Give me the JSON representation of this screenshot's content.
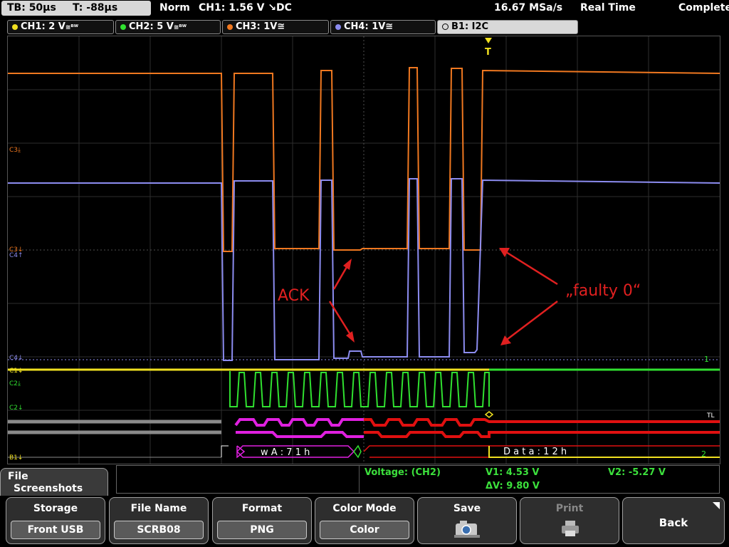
{
  "status_bar": {
    "timebase": "TB: 50µs",
    "trigger_time": "T: -88µs",
    "trigger_mode": "Norm",
    "trigger_setting": "CH1: 1.56 V ↘DC",
    "sample_rate": "16.67 MSa/s",
    "acquisition_mode": "Real Time",
    "acquisition_state": "Complete"
  },
  "channels": [
    {
      "label": "CH1: 2 V",
      "coupling": "≅ᴮᵂ",
      "color": "#f0e020"
    },
    {
      "label": "CH2: 5 V",
      "coupling": "≅ᴮᵂ",
      "color": "#30e030"
    },
    {
      "label": "CH3: 1V",
      "coupling": "≅",
      "color": "#f07820"
    },
    {
      "label": "CH4: 1V",
      "coupling": "≅",
      "color": "#8c8cf0"
    }
  ],
  "bus": {
    "label": "B1:  I2C",
    "decode_address": "w A : 7 1 h",
    "decode_data": "D a t a : 1 2 h"
  },
  "trace_markers": {
    "c3_top": "C3⤓",
    "c3_mid": "C3↓",
    "c4_mid": "C4↑",
    "c4_bottom": "C4↓",
    "c1": "C1↓",
    "c2_top": "C2⤓",
    "c2_bottom": "C2↓",
    "b1": "B1↓",
    "trigger": "T",
    "tl": "TL",
    "right_1": "1",
    "right_2": "2"
  },
  "annotations": {
    "ack": "ACK",
    "faulty": "„faulty 0“"
  },
  "measurement": {
    "source": "Voltage:  (CH2)",
    "v1": "V1: 4.53 V",
    "v2": "V2: -5.27 V",
    "delta_v": "ΔV: 9.80 V"
  },
  "menu": {
    "line1": "File",
    "line2": "Screenshots"
  },
  "softkeys": [
    {
      "label": "Storage",
      "value": "Front USB"
    },
    {
      "label": "File Name",
      "value": "SCRB08"
    },
    {
      "label": "Format",
      "value": "PNG"
    },
    {
      "label": "Color Mode",
      "value": "Color"
    },
    {
      "label": "Save",
      "icon": "camera-icon"
    },
    {
      "label": "Print",
      "icon": "printer-icon",
      "disabled": true
    },
    {
      "label": "Back"
    }
  ],
  "colors": {
    "ch1": "#f0e020",
    "ch2": "#30e030",
    "ch3": "#f07820",
    "ch4": "#8c8cf0",
    "bus_magenta": "#e020e0",
    "bus_red": "#e01010",
    "annotation": "#e02020"
  }
}
